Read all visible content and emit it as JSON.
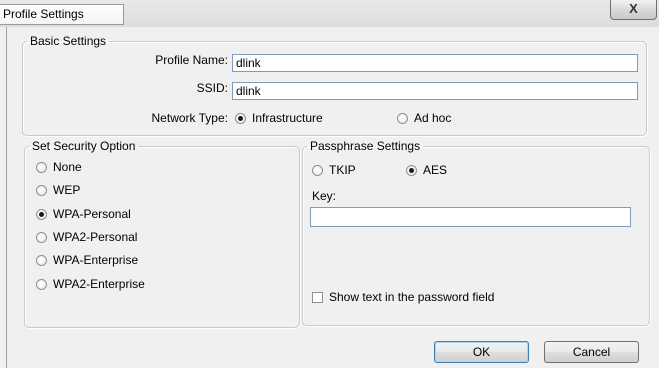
{
  "window": {
    "title": "Profile Settings",
    "close_glyph": "X"
  },
  "basic_settings": {
    "legend": "Basic Settings",
    "profile_name_label": "Profile Name:",
    "profile_name_value": "dlink",
    "ssid_label": "SSID:",
    "ssid_value": "dlink",
    "network_type_label": "Network Type:",
    "network_types": [
      {
        "label": "Infrastructure",
        "selected": true
      },
      {
        "label": "Ad hoc",
        "selected": false
      }
    ]
  },
  "security": {
    "legend": "Set Security Option",
    "options": [
      {
        "label": "None",
        "selected": false
      },
      {
        "label": "WEP",
        "selected": false
      },
      {
        "label": "WPA-Personal",
        "selected": true
      },
      {
        "label": "WPA2-Personal",
        "selected": false
      },
      {
        "label": "WPA-Enterprise",
        "selected": false
      },
      {
        "label": "WPA2-Enterprise",
        "selected": false
      }
    ]
  },
  "passphrase": {
    "legend": "Passphrase Settings",
    "ciphers": [
      {
        "label": "TKIP",
        "selected": false
      },
      {
        "label": "AES",
        "selected": true
      }
    ],
    "key_label": "Key:",
    "key_value": "",
    "show_text_label": "Show text in the password field",
    "show_text_checked": false
  },
  "buttons": {
    "ok": "OK",
    "cancel": "Cancel"
  }
}
